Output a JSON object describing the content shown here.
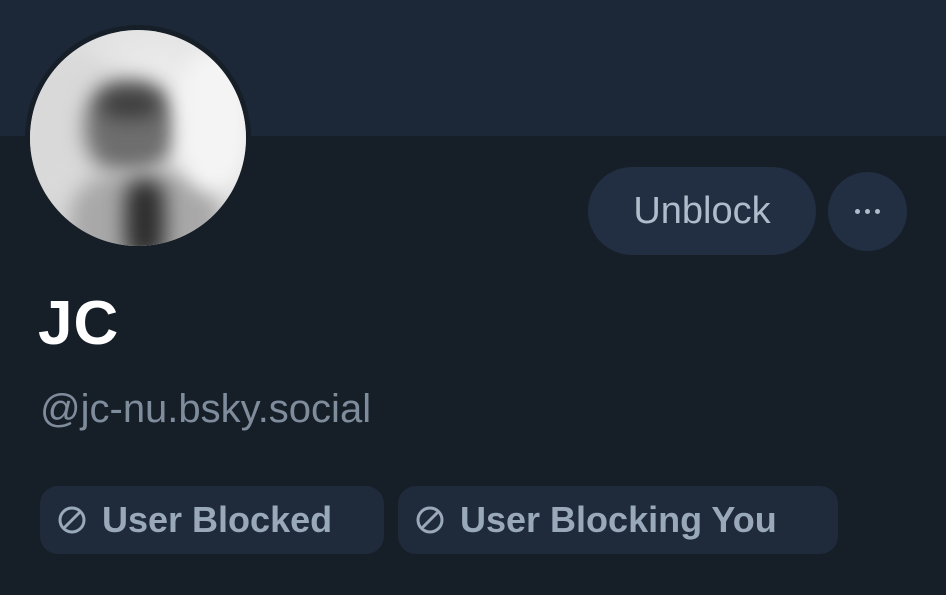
{
  "profile": {
    "display_name": "JC",
    "handle": "@jc-nu.bsky.social",
    "avatar_icon": "profile-photo"
  },
  "actions": {
    "unblock_label": "Unblock",
    "more_icon": "ellipsis-icon"
  },
  "labels": [
    {
      "icon": "blocked-icon",
      "text": "User Blocked"
    },
    {
      "icon": "blocked-icon",
      "text": "User Blocking You"
    }
  ],
  "colors": {
    "background": "#161e28",
    "banner": "#1c2838",
    "button_bg": "#222f42",
    "pill_bg": "#1f2b3b",
    "muted_text": "#7f8c9c"
  }
}
